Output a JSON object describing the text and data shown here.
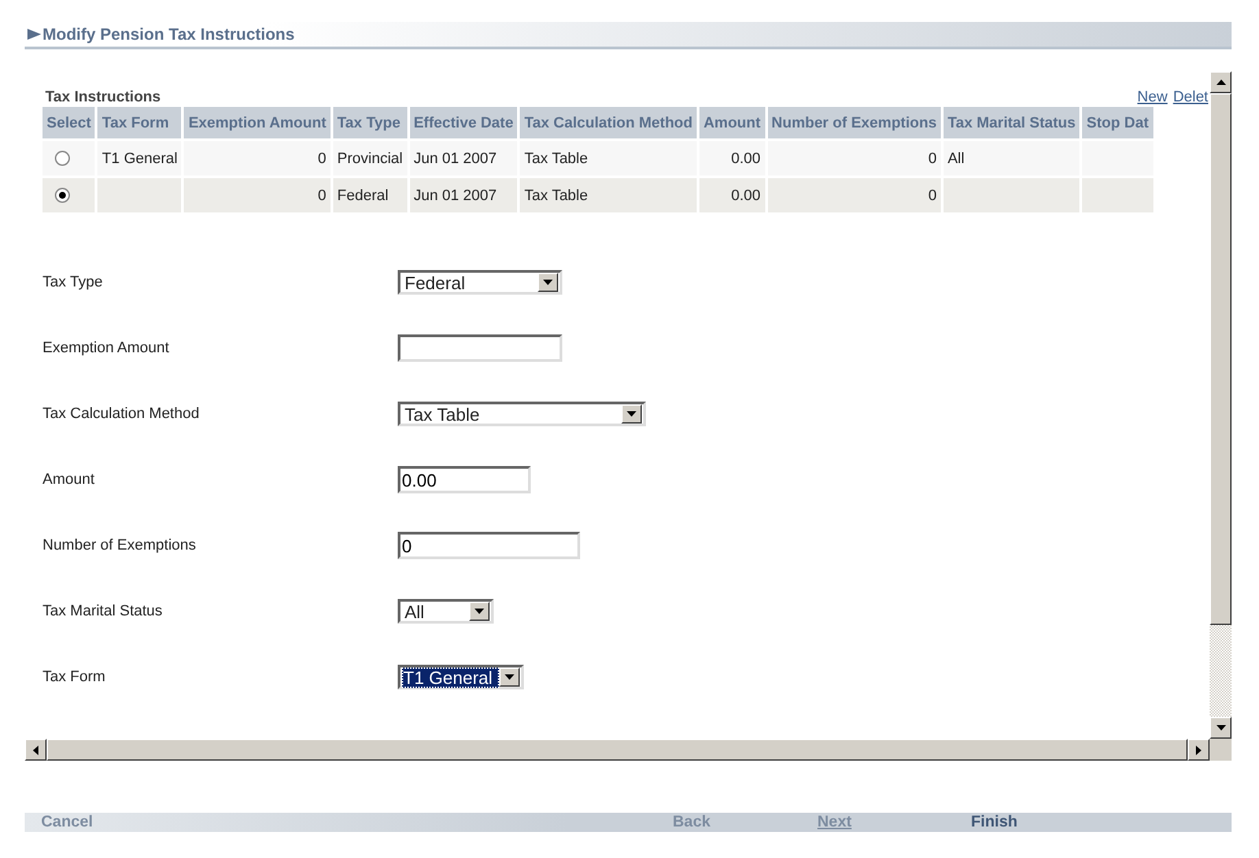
{
  "page_title": "Modify Pension Tax Instructions",
  "section_title": "Tax Instructions",
  "links": [
    {
      "label": "New"
    },
    {
      "label": "Delet"
    }
  ],
  "table": {
    "select_header": "Select",
    "columns": [
      {
        "label": "Tax Form"
      },
      {
        "label": "Exemption Amount"
      },
      {
        "label": "Tax Type"
      },
      {
        "label": "Effective Date"
      },
      {
        "label": "Tax Calculation Method"
      },
      {
        "label": "Amount"
      },
      {
        "label": "Number of Exemptions"
      },
      {
        "label": "Tax Marital Status"
      },
      {
        "label": "Stop Dat"
      }
    ],
    "rows": [
      {
        "selected": false,
        "cells": [
          "T1 General",
          "0",
          "Provincial",
          "Jun 01 2007",
          "Tax Table",
          "0.00",
          "0",
          "All",
          ""
        ]
      },
      {
        "selected": true,
        "cells": [
          "",
          "0",
          "Federal",
          "Jun 01 2007",
          "Tax Table",
          "0.00",
          "0",
          "",
          ""
        ]
      }
    ]
  },
  "form": [
    {
      "label": "Tax Type",
      "kind": "select",
      "value": "Federal",
      "focused": false
    },
    {
      "label": "Exemption Amount",
      "kind": "input",
      "focused": false
    },
    {
      "label": "Tax Calculation Method",
      "kind": "select",
      "value": "Tax Table",
      "focused": false
    },
    {
      "label": "Amount",
      "kind": "input",
      "value": "0.00",
      "focused": false
    },
    {
      "label": "Number of Exemptions",
      "kind": "input",
      "value": "0",
      "focused": false
    },
    {
      "label": "Tax Marital Status",
      "kind": "select",
      "value": "All",
      "focused": false
    },
    {
      "label": "Tax Form",
      "kind": "select",
      "value": "T1 General",
      "focused": true
    }
  ],
  "buttons": [
    {
      "label": "Cancel",
      "disabled": true,
      "hovered": false
    },
    {
      "label": "Back",
      "disabled": true,
      "hovered": false
    },
    {
      "label": "Next",
      "disabled": true,
      "hovered": true
    },
    {
      "label": "Finish",
      "disabled": false,
      "hovered": false
    }
  ]
}
